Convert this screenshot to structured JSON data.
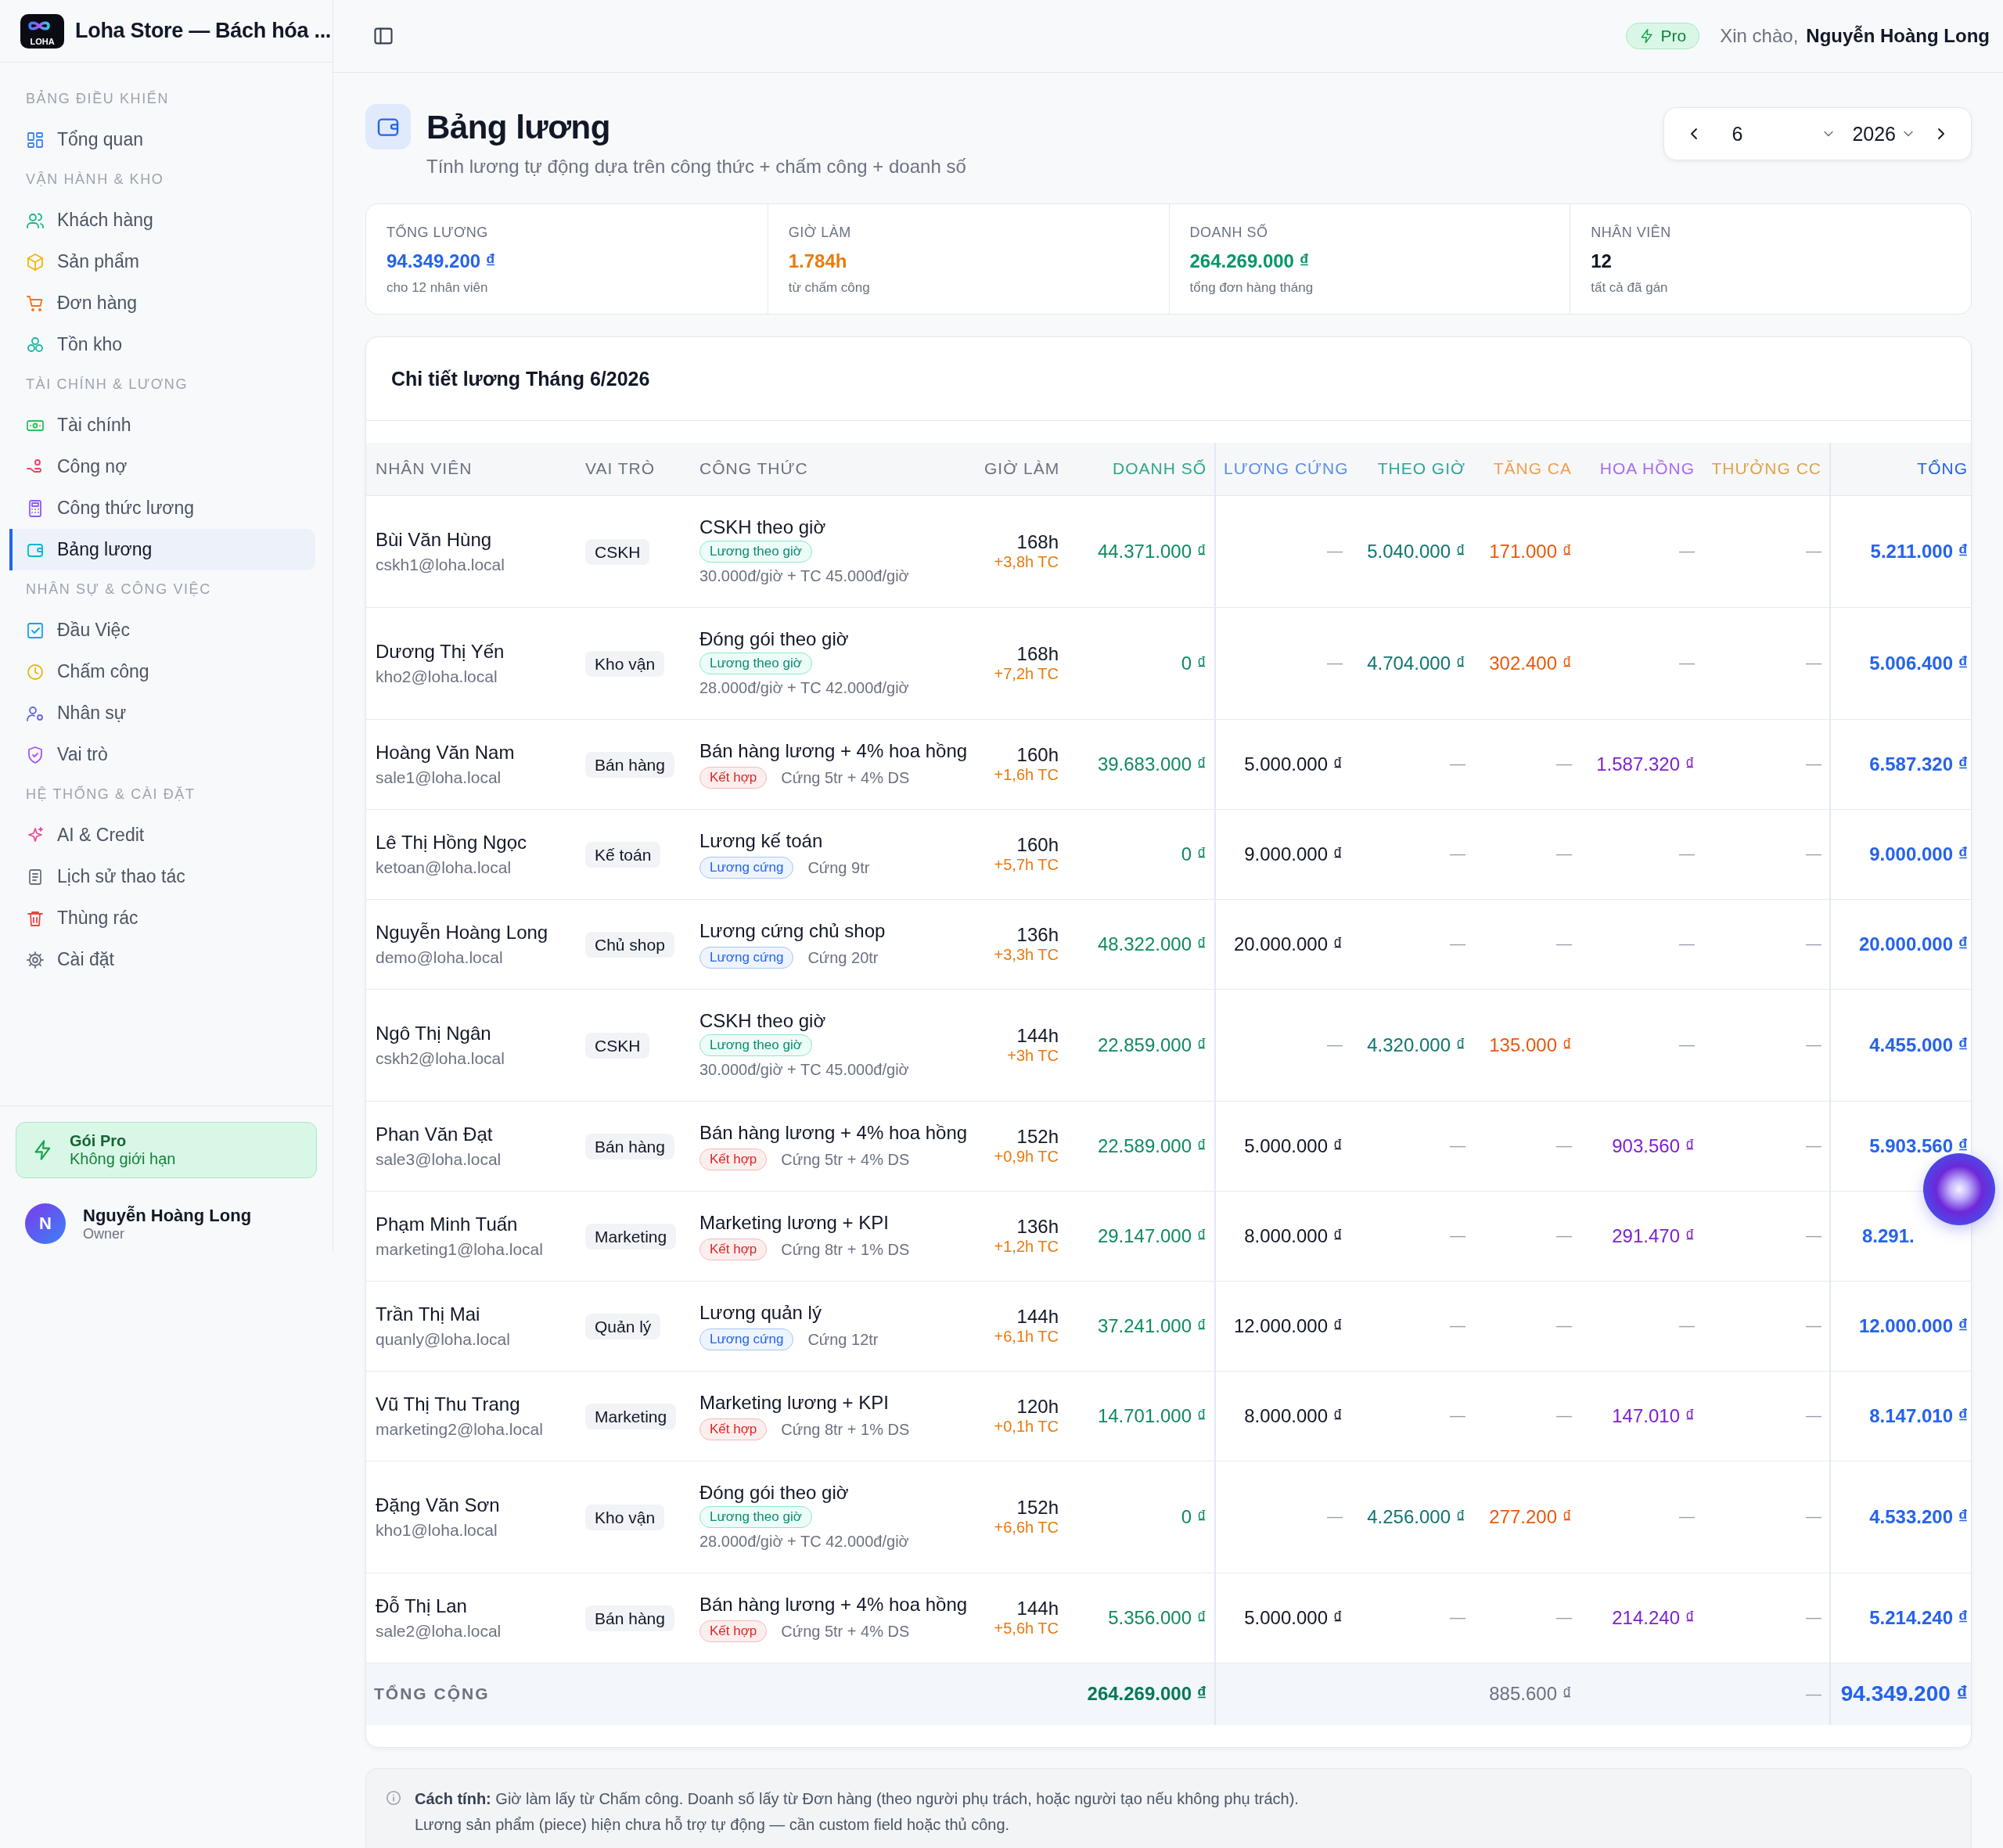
{
  "brand": {
    "logo_text": "LOHA",
    "title": "Loha Store — Bách hóa ..."
  },
  "sidebar": {
    "sections": [
      {
        "title": "BẢNG ĐIỀU KHIỂN",
        "items": [
          {
            "label": "Tổng quan",
            "selected": false
          }
        ]
      },
      {
        "title": "VẬN HÀNH & KHO",
        "items": [
          {
            "label": "Khách hàng",
            "selected": false
          },
          {
            "label": "Sản phẩm",
            "selected": false
          },
          {
            "label": "Đơn hàng",
            "selected": false
          },
          {
            "label": "Tồn kho",
            "selected": false
          }
        ]
      },
      {
        "title": "TÀI CHÍNH & LƯƠNG",
        "items": [
          {
            "label": "Tài chính",
            "selected": false
          },
          {
            "label": "Công nợ",
            "selected": false
          },
          {
            "label": "Công thức lương",
            "selected": false
          },
          {
            "label": "Bảng lương",
            "selected": true
          }
        ]
      },
      {
        "title": "NHÂN SỰ & CÔNG VIỆC",
        "items": [
          {
            "label": "Đầu Việc",
            "selected": false
          },
          {
            "label": "Chấm công",
            "selected": false
          },
          {
            "label": "Nhân sự",
            "selected": false
          },
          {
            "label": "Vai trò",
            "selected": false
          }
        ]
      },
      {
        "title": "HỆ THỐNG & CÀI ĐẶT",
        "items": [
          {
            "label": "AI & Credit",
            "selected": false
          },
          {
            "label": "Lịch sử thao tác",
            "selected": false
          },
          {
            "label": "Thùng rác",
            "selected": false
          },
          {
            "label": "Cài đặt",
            "selected": false
          }
        ]
      }
    ],
    "plan": {
      "title": "Gói Pro",
      "note": "Không giới hạn"
    },
    "user": {
      "initial": "N",
      "name": "Nguyễn Hoàng Long",
      "role": "Owner"
    }
  },
  "topbar": {
    "badge": "Pro",
    "greeting": "Xin chào,",
    "user_name": "Nguyễn Hoàng Long"
  },
  "page": {
    "title": "Bảng lương",
    "subtitle": "Tính lương tự động dựa trên công thức + chấm công + doanh số",
    "month": "6",
    "year": "2026"
  },
  "stats": [
    {
      "label": "TỔNG LƯƠNG",
      "value": "94.349.200 ₫",
      "note": "cho 12 nhân viên",
      "kind": "payroll"
    },
    {
      "label": "GIỜ LÀM",
      "value": "1.784h",
      "note": "từ chấm công",
      "kind": "hours"
    },
    {
      "label": "DOANH SỐ",
      "value": "264.269.000 ₫",
      "note": "tổng đơn hàng tháng",
      "kind": "sales"
    },
    {
      "label": "NHÂN VIÊN",
      "value": "12",
      "note": "tất cả đã gán",
      "kind": "count"
    }
  ],
  "table": {
    "title": "Chi tiết lương Tháng 6/2026",
    "columns": [
      {
        "label": "NHÂN VIÊN",
        "kind": "employee"
      },
      {
        "label": "VAI TRÒ",
        "kind": "role"
      },
      {
        "label": "CÔNG THỨC",
        "kind": "formula"
      },
      {
        "label": "GIỜ LÀM",
        "kind": "hours"
      },
      {
        "label": "DOANH SỐ",
        "kind": "sales"
      },
      {
        "label": "LƯƠNG CỨNG",
        "kind": "base"
      },
      {
        "label": "THEO GIỜ",
        "kind": "hourly"
      },
      {
        "label": "TĂNG CA",
        "kind": "overtime_pay"
      },
      {
        "label": "HOA HỒNG",
        "kind": "commission"
      },
      {
        "label": "THƯỞNG CC",
        "kind": "bonus"
      },
      {
        "label": "TỔNG",
        "kind": "total"
      }
    ],
    "rows": [
      {
        "name": "Bùi Văn Hùng",
        "email": "cskh1@loha.local",
        "role": "CSKH",
        "formula": "CSKH theo giờ",
        "formula_tag": {
          "label": "Lương theo giờ",
          "kind": "hourly"
        },
        "formula_detail": "30.000đ/giờ + TC 45.000đ/giờ",
        "hours": "168h",
        "overtime": "+3,8h TC",
        "sales": "44.371.000 ₫",
        "base": {
          "text": "—",
          "empty": true
        },
        "hourly": "5.040.000 ₫",
        "overtime_pay": "171.000 ₫",
        "commission": {
          "text": "—",
          "empty": true
        },
        "bonus": {
          "text": "—",
          "empty": true
        },
        "total": "5.211.000 ₫"
      },
      {
        "name": "Dương Thị Yến",
        "email": "kho2@loha.local",
        "role": "Kho vận",
        "formula": "Đóng gói theo giờ",
        "formula_tag": {
          "label": "Lương theo giờ",
          "kind": "hourly"
        },
        "formula_detail": "28.000đ/giờ + TC 42.000đ/giờ",
        "hours": "168h",
        "overtime": "+7,2h TC",
        "sales": "0 ₫",
        "base": {
          "text": "—",
          "empty": true
        },
        "hourly": "4.704.000 ₫",
        "overtime_pay": "302.400 ₫",
        "commission": {
          "text": "—",
          "empty": true
        },
        "bonus": {
          "text": "—",
          "empty": true
        },
        "total": "5.006.400 ₫"
      },
      {
        "name": "Hoàng Văn Nam",
        "email": "sale1@loha.local",
        "role": "Bán hàng",
        "formula": "Bán hàng lương + 4% hoa hồng",
        "formula_tag": {
          "label": "Kết hợp",
          "kind": "combo"
        },
        "formula_detail": "Cứng 5tr + 4% DS",
        "hours": "160h",
        "overtime": "+1,6h TC",
        "sales": "39.683.000 ₫",
        "base": "5.000.000 ₫",
        "hourly": {
          "text": "—",
          "empty": true
        },
        "overtime_pay": {
          "text": "—",
          "empty": true
        },
        "commission": "1.587.320 ₫",
        "bonus": {
          "text": "—",
          "empty": true
        },
        "total": "6.587.320 ₫"
      },
      {
        "name": "Lê Thị Hồng Ngọc",
        "email": "ketoan@loha.local",
        "role": "Kế toán",
        "formula": "Lương kế toán",
        "formula_tag": {
          "label": "Lương cứng",
          "kind": "fixed"
        },
        "formula_detail": "Cứng 9tr",
        "hours": "160h",
        "overtime": "+5,7h TC",
        "sales": "0 ₫",
        "base": "9.000.000 ₫",
        "hourly": {
          "text": "—",
          "empty": true
        },
        "overtime_pay": {
          "text": "—",
          "empty": true
        },
        "commission": {
          "text": "—",
          "empty": true
        },
        "bonus": {
          "text": "—",
          "empty": true
        },
        "total": "9.000.000 ₫"
      },
      {
        "name": "Nguyễn Hoàng Long",
        "email": "demo@loha.local",
        "role": "Chủ shop",
        "formula": "Lương cứng chủ shop",
        "formula_tag": {
          "label": "Lương cứng",
          "kind": "fixed"
        },
        "formula_detail": "Cứng 20tr",
        "hours": "136h",
        "overtime": "+3,3h TC",
        "sales": "48.322.000 ₫",
        "base": "20.000.000 ₫",
        "hourly": {
          "text": "—",
          "empty": true
        },
        "overtime_pay": {
          "text": "—",
          "empty": true
        },
        "commission": {
          "text": "—",
          "empty": true
        },
        "bonus": {
          "text": "—",
          "empty": true
        },
        "total": "20.000.000 ₫"
      },
      {
        "name": "Ngô Thị Ngân",
        "email": "cskh2@loha.local",
        "role": "CSKH",
        "formula": "CSKH theo giờ",
        "formula_tag": {
          "label": "Lương theo giờ",
          "kind": "hourly"
        },
        "formula_detail": "30.000đ/giờ + TC 45.000đ/giờ",
        "hours": "144h",
        "overtime": "+3h TC",
        "sales": "22.859.000 ₫",
        "base": {
          "text": "—",
          "empty": true
        },
        "hourly": "4.320.000 ₫",
        "overtime_pay": "135.000 ₫",
        "commission": {
          "text": "—",
          "empty": true
        },
        "bonus": {
          "text": "—",
          "empty": true
        },
        "total": "4.455.000 ₫"
      },
      {
        "name": "Phan Văn Đạt",
        "email": "sale3@loha.local",
        "role": "Bán hàng",
        "formula": "Bán hàng lương + 4% hoa hồng",
        "formula_tag": {
          "label": "Kết hợp",
          "kind": "combo"
        },
        "formula_detail": "Cứng 5tr + 4% DS",
        "hours": "152h",
        "overtime": "+0,9h TC",
        "sales": "22.589.000 ₫",
        "base": "5.000.000 ₫",
        "hourly": {
          "text": "—",
          "empty": true
        },
        "overtime_pay": {
          "text": "—",
          "empty": true
        },
        "commission": "903.560 ₫",
        "bonus": {
          "text": "—",
          "empty": true
        },
        "total": "5.903.560 ₫"
      },
      {
        "name": "Phạm Minh Tuấn",
        "email": "marketing1@loha.local",
        "role": "Marketing",
        "formula": "Marketing lương + KPI",
        "formula_tag": {
          "label": "Kết hợp",
          "kind": "combo"
        },
        "formula_detail": "Cứng 8tr + 1% DS",
        "hours": "136h",
        "overtime": "+1,2h TC",
        "sales": "29.147.000 ₫",
        "base": "8.000.000 ₫",
        "hourly": {
          "text": "—",
          "empty": true
        },
        "overtime_pay": {
          "text": "—",
          "empty": true
        },
        "commission": "291.470 ₫",
        "bonus": {
          "text": "—",
          "empty": true
        },
        "total": {
          "text": "8.291.",
          "covered": true
        }
      },
      {
        "name": "Trần Thị Mai",
        "email": "quanly@loha.local",
        "role": "Quản lý",
        "formula": "Lương quản lý",
        "formula_tag": {
          "label": "Lương cứng",
          "kind": "fixed"
        },
        "formula_detail": "Cứng 12tr",
        "hours": "144h",
        "overtime": "+6,1h TC",
        "sales": "37.241.000 ₫",
        "base": "12.000.000 ₫",
        "hourly": {
          "text": "—",
          "empty": true
        },
        "overtime_pay": {
          "text": "—",
          "empty": true
        },
        "commission": {
          "text": "—",
          "empty": true
        },
        "bonus": {
          "text": "—",
          "empty": true
        },
        "total": "12.000.000 ₫"
      },
      {
        "name": "Vũ Thị Thu Trang",
        "email": "marketing2@loha.local",
        "role": "Marketing",
        "formula": "Marketing lương + KPI",
        "formula_tag": {
          "label": "Kết hợp",
          "kind": "combo"
        },
        "formula_detail": "Cứng 8tr + 1% DS",
        "hours": "120h",
        "overtime": "+0,1h TC",
        "sales": "14.701.000 ₫",
        "base": "8.000.000 ₫",
        "hourly": {
          "text": "—",
          "empty": true
        },
        "overtime_pay": {
          "text": "—",
          "empty": true
        },
        "commission": "147.010 ₫",
        "bonus": {
          "text": "—",
          "empty": true
        },
        "total": "8.147.010 ₫"
      },
      {
        "name": "Đặng Văn Sơn",
        "email": "kho1@loha.local",
        "role": "Kho vận",
        "formula": "Đóng gói theo giờ",
        "formula_tag": {
          "label": "Lương theo giờ",
          "kind": "hourly"
        },
        "formula_detail": "28.000đ/giờ + TC 42.000đ/giờ",
        "hours": "152h",
        "overtime": "+6,6h TC",
        "sales": "0 ₫",
        "base": {
          "text": "—",
          "empty": true
        },
        "hourly": "4.256.000 ₫",
        "overtime_pay": "277.200 ₫",
        "commission": {
          "text": "—",
          "empty": true
        },
        "bonus": {
          "text": "—",
          "empty": true
        },
        "total": "4.533.200 ₫"
      },
      {
        "name": "Đỗ Thị Lan",
        "email": "sale2@loha.local",
        "role": "Bán hàng",
        "formula": "Bán hàng lương + 4% hoa hồng",
        "formula_tag": {
          "label": "Kết hợp",
          "kind": "combo"
        },
        "formula_detail": "Cứng 5tr + 4% DS",
        "hours": "144h",
        "overtime": "+5,6h TC",
        "sales": "5.356.000 ₫",
        "base": "5.000.000 ₫",
        "hourly": {
          "text": "—",
          "empty": true
        },
        "overtime_pay": {
          "text": "—",
          "empty": true
        },
        "commission": "214.240 ₫",
        "bonus": {
          "text": "—",
          "empty": true
        },
        "total": "5.214.240 ₫"
      }
    ],
    "totals": {
      "label": "TỔNG CỘNG",
      "sales": "264.269.000 ₫",
      "overtime_pay": "885.600 ₫",
      "bonus": {
        "text": "—",
        "empty": true
      },
      "total": "94.349.200 ₫"
    }
  },
  "note": {
    "lines": [
      "**Cách tính:** Giờ làm lấy từ Chấm công. Doanh số lấy từ Đơn hàng (theo người phụ trách, hoặc người tạo nếu không phụ trách).",
      "Lương sản phẩm (piece) hiện chưa hỗ trợ tự động — cần custom field hoặc thủ công."
    ]
  }
}
